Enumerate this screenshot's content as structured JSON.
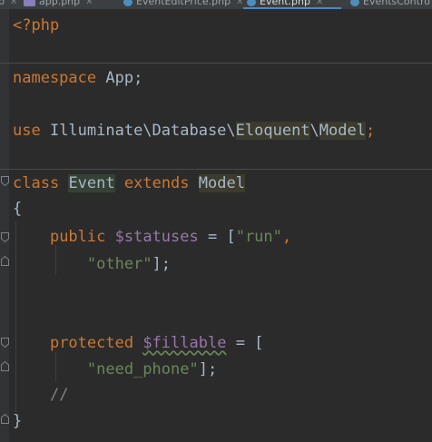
{
  "tabs": [
    {
      "label": "p",
      "active": false,
      "icon": "",
      "color": ""
    },
    {
      "label": "app.php",
      "active": false,
      "icon": "php-file-icon",
      "color": "#8a7fbd"
    },
    {
      "label": "EventEditPrice.php",
      "active": false,
      "icon": "php-class-icon",
      "color": "#4c8fbf"
    },
    {
      "label": "Event.php",
      "active": true,
      "icon": "php-class-icon",
      "color": "#4c8fbf"
    },
    {
      "label": "EventsContro",
      "active": false,
      "icon": "php-class-icon",
      "color": "#4c8fbf"
    }
  ],
  "code": {
    "open_tag": "<?php",
    "namespace_kw": "namespace",
    "namespace_name": " App;",
    "use_kw": "use",
    "use_path_1": " Illuminate\\Database\\",
    "use_path_eloquent": "Eloquent",
    "use_path_sep": "\\",
    "use_path_model": "Model",
    "use_end": ";",
    "class_kw": "class",
    "class_name": "Event",
    "extends_kw": "extends",
    "parent_class": "Model",
    "open_brace": "{",
    "public_kw": "public",
    "statuses_var": "$statuses",
    "statuses_eq": " = [",
    "str_run": "\"run\"",
    "comma": ",",
    "str_other": "\"other\"",
    "arr_close": "];",
    "protected_kw": "protected",
    "fillable_var": "$fillable",
    "fillable_eq": " = [",
    "str_need_phone": "\"need_phone\"",
    "comment": "//",
    "close_brace": "}"
  },
  "colors": {
    "keyword": "#cc7832",
    "string": "#6a8759",
    "variable": "#9876aa",
    "text": "#a9b7c6",
    "background": "#2b2b2b"
  }
}
